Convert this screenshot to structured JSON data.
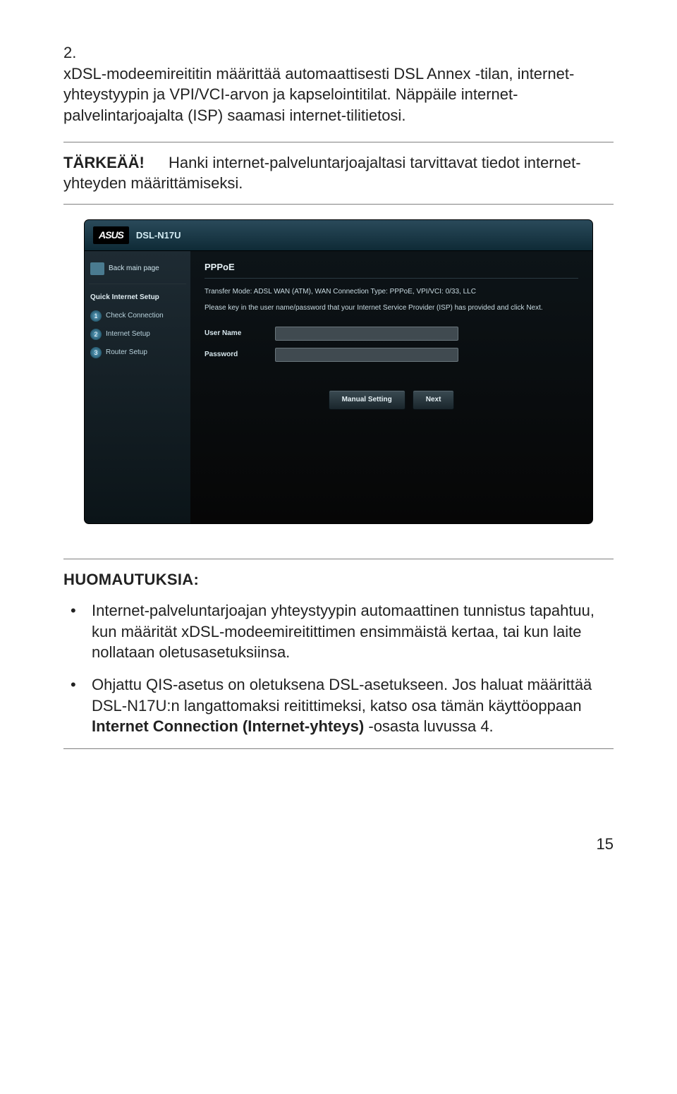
{
  "step": {
    "number": "2.",
    "text": "xDSL-modeemireititin määrittää automaattisesti DSL Annex -tilan, internet-yhteystyypin ja VPI/VCI-arvon ja kapselointitilat. Näppäile internet-palvelintarjoajalta (ISP) saamasi internet-tilitietosi."
  },
  "important": {
    "label": "TÄRKEÄÄ!",
    "text": "Hanki internet-palveluntarjoajaltasi tarvittavat tiedot internet-yhteyden määrittämiseksi."
  },
  "screenshot": {
    "brand": "ASUS",
    "model": "DSL-N17U",
    "back_label": "Back main page",
    "section_title": "Quick Internet Setup",
    "steps": [
      {
        "num": "1",
        "label": "Check Connection"
      },
      {
        "num": "2",
        "label": "Internet Setup"
      },
      {
        "num": "3",
        "label": "Router Setup"
      }
    ],
    "panel_title": "PPPoE",
    "info1": "Transfer Mode: ADSL WAN (ATM), WAN Connection Type: PPPoE, VPI/VCI: 0/33, LLC",
    "info2": "Please key in the user name/password that your Internet Service Provider (ISP) has provided and click Next.",
    "field_user": "User Name",
    "field_pass": "Password",
    "btn_manual": "Manual Setting",
    "btn_next": "Next"
  },
  "notes": {
    "title": "HUOMAUTUKSIA:",
    "item1": "Internet-palveluntarjoajan yhteystyypin automaattinen tunnistus tapahtuu, kun määrität xDSL-modeemireitittimen ensimmäistä kertaa, tai kun laite nollataan oletusasetuksiinsa.",
    "item2_pre": "Ohjattu QIS-asetus on oletuksena DSL-asetukseen. Jos haluat määrittää DSL-N17U:n langattomaksi reitittimeksi, katso osa tämän käyttöoppaan ",
    "item2_bold": "Internet Connection (Internet-yhteys)",
    "item2_post": " -osasta luvussa 4."
  },
  "page_number": "15"
}
